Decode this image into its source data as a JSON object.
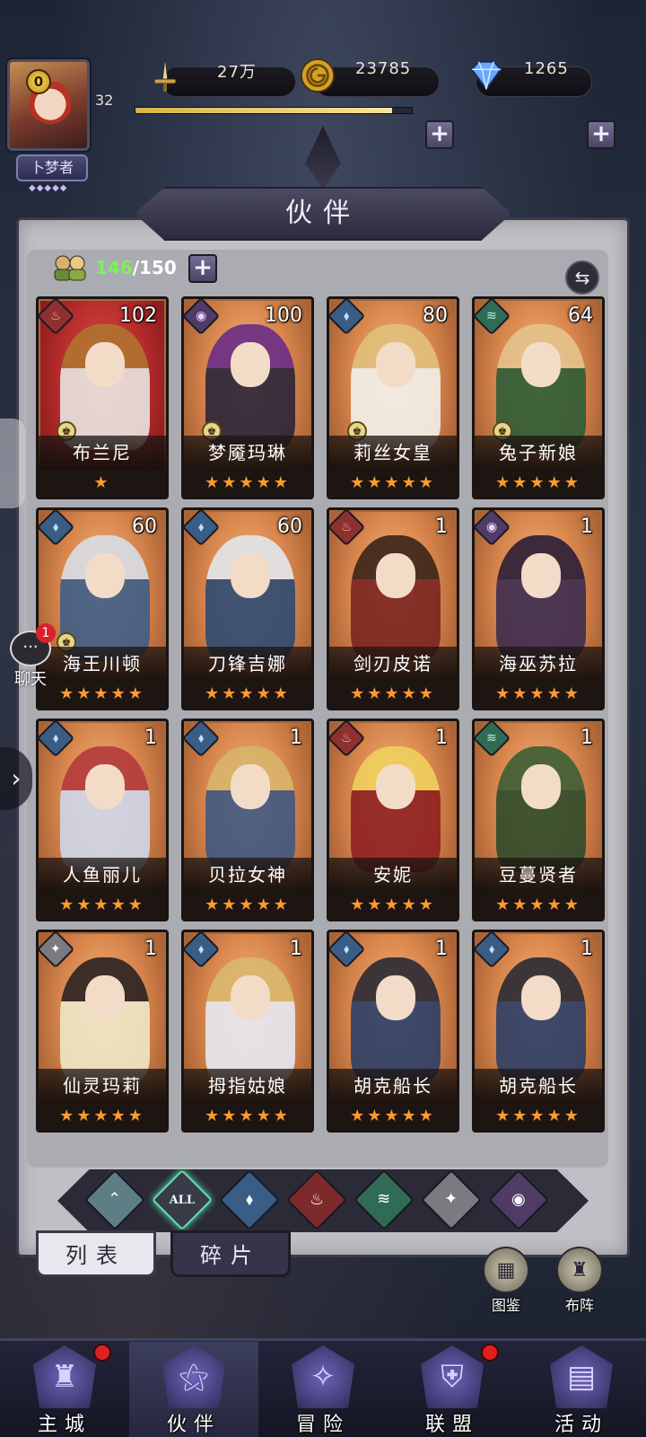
{
  "player": {
    "vip": "0",
    "level": "32",
    "xp_fraction": 0.93,
    "title": "卜梦者"
  },
  "resources": {
    "power": "27万",
    "gold": "23785",
    "diamonds": "1265"
  },
  "panel": {
    "title": "伙伴",
    "count_current": "146",
    "count_max": "/150"
  },
  "heroes": [
    {
      "name": "布兰尼",
      "level": "102",
      "stars": "★",
      "element": "fire",
      "crown": true,
      "bg": "red",
      "hair": "#b0722f",
      "body": "#e8e4e0"
    },
    {
      "name": "梦魇玛琳",
      "level": "100",
      "stars": "★★★★★",
      "element": "dark",
      "crown": true,
      "bg": "orange",
      "hair": "#6a2c86",
      "body": "#2a2438"
    },
    {
      "name": "莉丝女皇",
      "level": "80",
      "stars": "★★★★★",
      "element": "water",
      "crown": true,
      "bg": "orange",
      "hair": "#e1c07a",
      "body": "#f2f0ea"
    },
    {
      "name": "兔子新娘",
      "level": "64",
      "stars": "★★★★★",
      "element": "wind",
      "crown": true,
      "bg": "orange",
      "hair": "#e5c28b",
      "body": "#2d5b35"
    },
    {
      "name": "海王川顿",
      "level": "60",
      "stars": "★★★★★",
      "element": "water",
      "crown": true,
      "bg": "orange",
      "hair": "#d8dde6",
      "body": "#3f5d86"
    },
    {
      "name": "刀锋吉娜",
      "level": "60",
      "stars": "★★★★★",
      "element": "water",
      "crown": false,
      "bg": "orange",
      "hair": "#e3e6ec",
      "body": "#2d4a72"
    },
    {
      "name": "剑刃皮诺",
      "level": "1",
      "stars": "★★★★★",
      "element": "fire",
      "crown": false,
      "bg": "orange",
      "hair": "#3a2418",
      "body": "#7a2420"
    },
    {
      "name": "海巫苏拉",
      "level": "1",
      "stars": "★★★★★",
      "element": "dark",
      "crown": false,
      "bg": "orange",
      "hair": "#2a1e36",
      "body": "#3b2b4e"
    },
    {
      "name": "人鱼丽儿",
      "level": "1",
      "stars": "★★★★★",
      "element": "water",
      "crown": false,
      "bg": "orange",
      "hair": "#b33a3a",
      "body": "#cfd6ea"
    },
    {
      "name": "贝拉女神",
      "level": "1",
      "stars": "★★★★★",
      "element": "water",
      "crown": false,
      "bg": "orange",
      "hair": "#d9b46a",
      "body": "#3f5880"
    },
    {
      "name": "安妮",
      "level": "1",
      "stars": "★★★★★",
      "element": "fire",
      "crown": false,
      "bg": "orange",
      "hair": "#f0cf5c",
      "body": "#8e2020"
    },
    {
      "name": "豆蔓贤者",
      "level": "1",
      "stars": "★★★★★",
      "element": "wind",
      "crown": false,
      "bg": "orange",
      "hair": "#3c5e34",
      "body": "#2e4a2a"
    },
    {
      "name": "仙灵玛莉",
      "level": "1",
      "stars": "★★★★★",
      "element": "light",
      "crown": false,
      "bg": "orange",
      "hair": "#2a2220",
      "body": "#efe6c8"
    },
    {
      "name": "拇指姑娘",
      "level": "1",
      "stars": "★★★★★",
      "element": "water",
      "crown": false,
      "bg": "orange",
      "hair": "#d9b86c",
      "body": "#e6e8f2"
    },
    {
      "name": "胡克船长",
      "level": "1",
      "stars": "★★★★★",
      "element": "water",
      "crown": false,
      "bg": "orange",
      "hair": "#2a2a34",
      "body": "#2b3f66"
    },
    {
      "name": "胡克船长",
      "level": "1",
      "stars": "★★★★★",
      "element": "water",
      "crown": false,
      "bg": "orange",
      "hair": "#2a2a34",
      "body": "#2b3f66"
    }
  ],
  "filters": {
    "all_label": "ALL",
    "items": [
      "arrow",
      "all",
      "water",
      "fire",
      "wind",
      "light",
      "dark"
    ]
  },
  "subtabs": {
    "list": "列表",
    "fragments": "碎片"
  },
  "side_buttons": {
    "codex": "图鉴",
    "formation": "布阵"
  },
  "chat": {
    "label": "聊天",
    "badge": "1"
  },
  "nav": [
    {
      "label": "主城",
      "icon": "castle-icon",
      "dot": true
    },
    {
      "label": "伙伴",
      "icon": "witch-hat-icon",
      "dot": false,
      "active": true
    },
    {
      "label": "冒险",
      "icon": "compass-icon",
      "dot": false
    },
    {
      "label": "联盟",
      "icon": "shield-icon",
      "dot": true
    },
    {
      "label": "活动",
      "icon": "cards-icon",
      "dot": false
    }
  ],
  "colors": {
    "star": "#ff9a2e",
    "count_current": "#7ef05b",
    "xp_fill": "#e6c65a"
  }
}
